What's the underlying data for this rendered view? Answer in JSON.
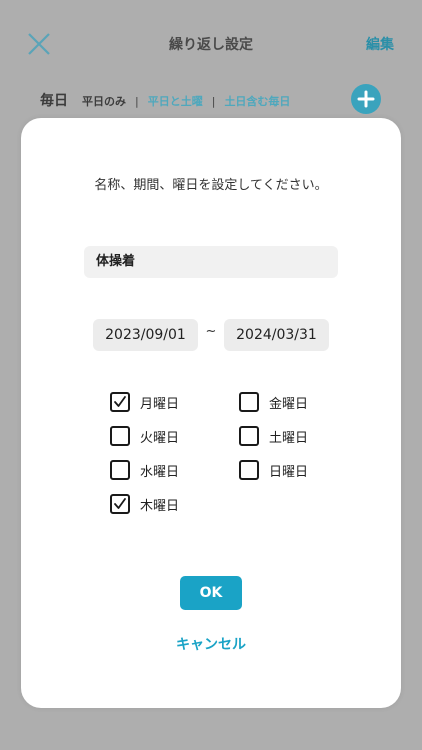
{
  "header": {
    "title": "繰り返し設定",
    "edit_label": "編集",
    "close_icon": "close-icon",
    "colors": {
      "accent": "#2a8fa8"
    }
  },
  "filters": {
    "daily_label": "毎日",
    "options": [
      {
        "label": "平日のみ",
        "selected": true
      },
      {
        "label": "平日と土曜",
        "selected": false
      },
      {
        "label": "土日含む毎日",
        "selected": false
      }
    ],
    "separator": "|",
    "add_icon": "plus-icon"
  },
  "dialog": {
    "instruction": "名称、期間、曜日を設定してください。",
    "name_value": "体操着",
    "start_date": "2023/09/01",
    "range_separator": "~",
    "end_date": "2024/03/31",
    "days": [
      {
        "label": "月曜日",
        "checked": true
      },
      {
        "label": "火曜日",
        "checked": false
      },
      {
        "label": "水曜日",
        "checked": false
      },
      {
        "label": "木曜日",
        "checked": true
      },
      {
        "label": "金曜日",
        "checked": false
      },
      {
        "label": "土曜日",
        "checked": false
      },
      {
        "label": "日曜日",
        "checked": false
      }
    ],
    "ok_label": "OK",
    "cancel_label": "キャンセル",
    "colors": {
      "button": "#1aa3c6"
    }
  }
}
